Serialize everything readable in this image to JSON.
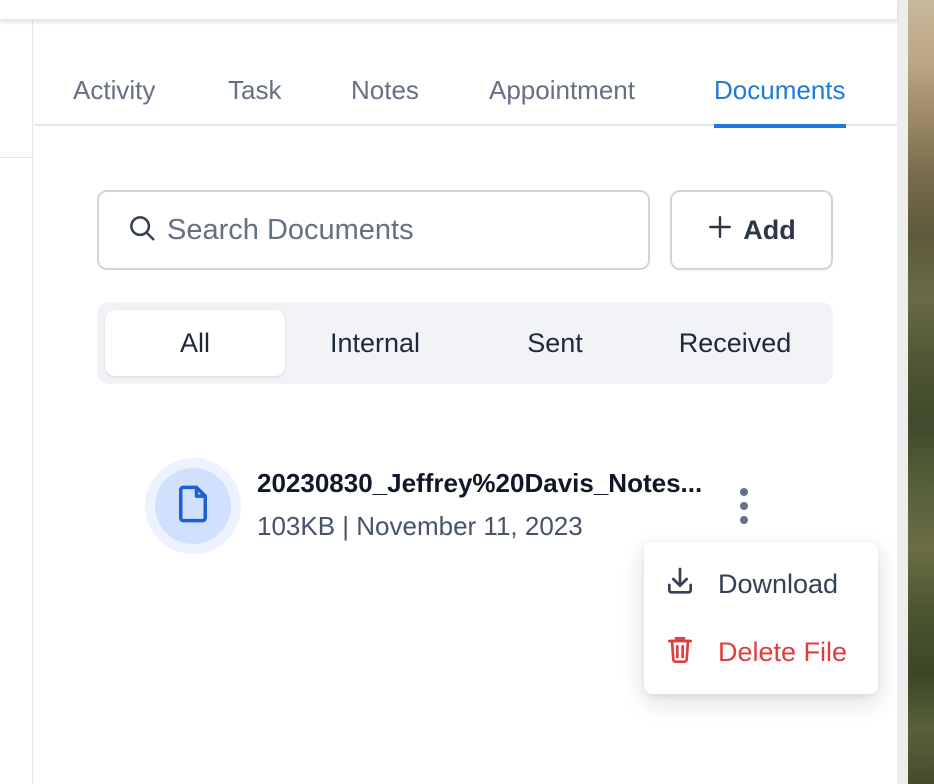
{
  "tabs": [
    {
      "label": "Activity"
    },
    {
      "label": "Task"
    },
    {
      "label": "Notes"
    },
    {
      "label": "Appointment"
    },
    {
      "label": "Documents",
      "active": true
    }
  ],
  "search": {
    "placeholder": "Search Documents",
    "value": "",
    "icon": "search-icon"
  },
  "add_button": {
    "label": "Add",
    "icon": "plus-icon"
  },
  "filters": [
    {
      "label": "All",
      "active": true
    },
    {
      "label": "Internal"
    },
    {
      "label": "Sent"
    },
    {
      "label": "Received"
    }
  ],
  "documents": [
    {
      "name": "20230830_Jeffrey%20Davis_Notes...",
      "meta": "103KB | November 11, 2023",
      "icon": "file-icon"
    }
  ],
  "context_menu": {
    "items": [
      {
        "label": "Download",
        "icon": "download-icon"
      },
      {
        "label": "Delete File",
        "icon": "trash-icon",
        "danger": true
      }
    ]
  },
  "colors": {
    "accent": "#1f7ae0",
    "danger": "#e03d3d",
    "text_muted": "#667085",
    "segment_bg": "#f1f3f6"
  }
}
